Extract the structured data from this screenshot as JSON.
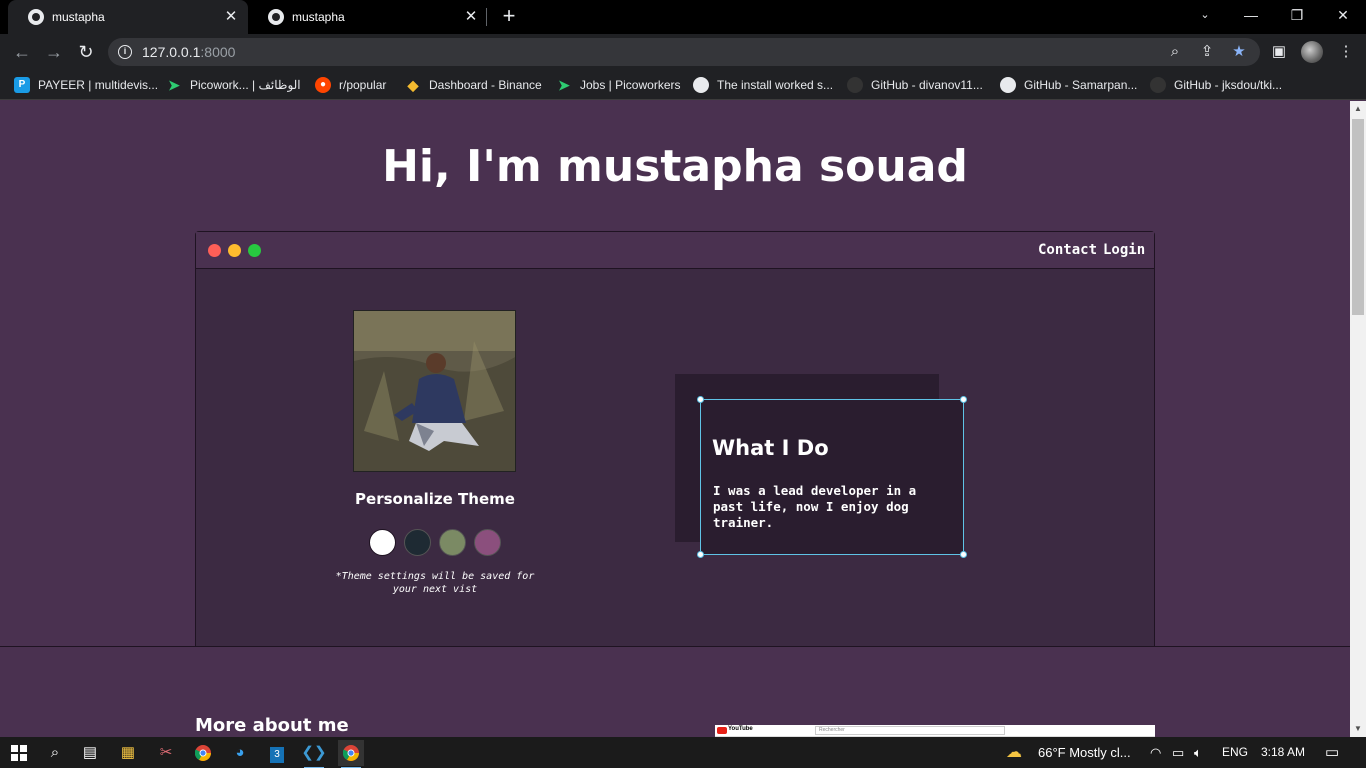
{
  "browser": {
    "tabs": [
      {
        "title": "mustapha",
        "active": true
      },
      {
        "title": "mustapha",
        "active": false
      }
    ],
    "new_tab_glyph": "+",
    "url_host": "127.0.0.1",
    "url_port": ":8000",
    "bookmarks": [
      {
        "label": "PAYEER | multidevis...",
        "icon": "payeer-icon",
        "color": "#1a9be6"
      },
      {
        "label": "Picowork... | الوظائف",
        "icon": "picoworkers-icon",
        "color": "#2ecc71"
      },
      {
        "label": "r/popular",
        "icon": "reddit-icon",
        "color": "#ff4500"
      },
      {
        "label": "Dashboard - Binance",
        "icon": "binance-icon",
        "color": "#f3ba2f"
      },
      {
        "label": "Jobs | Picoworkers",
        "icon": "picoworkers-icon",
        "color": "#2ecc71"
      },
      {
        "label": "The install worked s...",
        "icon": "globe-icon",
        "color": "#e8eaed"
      },
      {
        "label": "GitHub - divanov11...",
        "icon": "github-icon",
        "color": "#333333"
      },
      {
        "label": "GitHub - Samarpan...",
        "icon": "globe-icon",
        "color": "#e8eaed"
      },
      {
        "label": "GitHub - jksdou/tki...",
        "icon": "github-icon",
        "color": "#333333"
      }
    ]
  },
  "page": {
    "hero_title": "Hi, I'm mustapha souad",
    "nav": {
      "contact": "Contact",
      "login": "Login"
    },
    "theme": {
      "title": "Personalize Theme",
      "swatches": [
        "#ffffff",
        "#1e2a33",
        "#7b8a64",
        "#8b4f7d"
      ],
      "note": "*Theme settings will be saved for your next vist"
    },
    "card": {
      "title": "What I Do",
      "text": "I was a lead developer in a past life, now I enjoy dog trainer."
    },
    "more_title": "More about me",
    "youtube_preview": {
      "logo": "YouTube",
      "search_placeholder": "Rechercher"
    }
  },
  "taskbar": {
    "weather": "66°F  Mostly cl...",
    "language": "ENG",
    "time": "3:18 AM"
  },
  "colors": {
    "page_bg": "#4a3150",
    "window_bg": "#3c2a42",
    "card_bg": "#2a1d2f",
    "selection": "#5fc3e6"
  }
}
